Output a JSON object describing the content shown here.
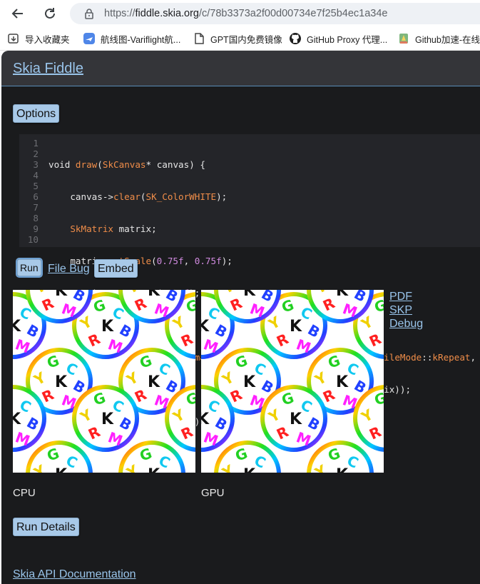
{
  "browser": {
    "url_prefix": "https://",
    "url_host": "fiddle.skia.org",
    "url_path": "/c/78b3373a2f00d00734e7f25b4ec1a34e",
    "bookmarks": [
      {
        "label": "导入收藏夹",
        "icon": "import-icon"
      },
      {
        "label": "航线图-Varifl​ight航...",
        "icon": "plane-app-icon"
      },
      {
        "label": "GPT国内免费镜像",
        "icon": "document-icon"
      },
      {
        "label": "GitHub Proxy 代理...",
        "icon": "github-icon"
      },
      {
        "label": "Github加速-在线",
        "icon": "rocket-icon"
      }
    ]
  },
  "header": {
    "title": "Skia Fiddle"
  },
  "options_label": "Options",
  "code_lines": [
    "1",
    "2",
    "3",
    "4",
    "5",
    "6",
    "7",
    "8",
    "9",
    "10"
  ],
  "actions": {
    "run": "Run",
    "file_bug": "File Bug",
    "embed": "Embed"
  },
  "side_links": {
    "pdf": "PDF",
    "skp": "SKP",
    "debug": "Debug"
  },
  "captions": {
    "cpu": "CPU",
    "gpu": "GPU"
  },
  "details_label": "Run Details",
  "footer_link": "Skia API Documentation",
  "colors": {
    "page_bg": "#1a1b1d",
    "header_bg": "#343539",
    "link": "#99c4ea",
    "button": "#a8c9e8"
  }
}
